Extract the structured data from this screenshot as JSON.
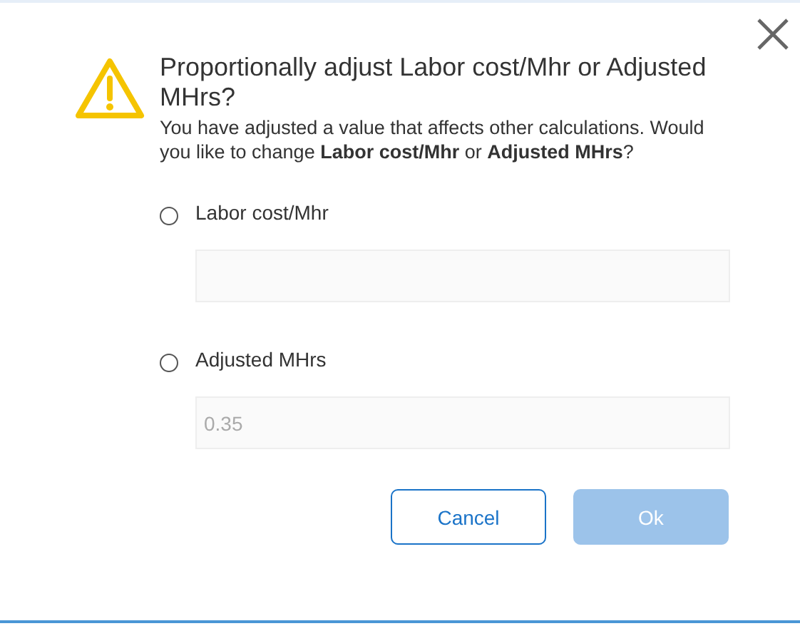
{
  "dialog": {
    "title": "Proportionally adjust Labor cost/Mhr or Adjusted MHrs?",
    "message": "You have adjusted a value that affects other calculations. Would you like to change **Labor cost/Mhr** or **Adjusted MHrs**?",
    "options": [
      {
        "label": "Labor cost/Mhr",
        "selected": false,
        "field": {
          "disabled": true
        }
      },
      {
        "label": "Adjusted MHrs",
        "selected": false,
        "field": {
          "value": "0.35",
          "disabled": true
        }
      }
    ],
    "buttons": [
      {
        "label": "Cancel",
        "kind": "secondary",
        "disabled": false
      },
      {
        "label": "Ok",
        "kind": "primary",
        "disabled": true
      }
    ]
  }
}
